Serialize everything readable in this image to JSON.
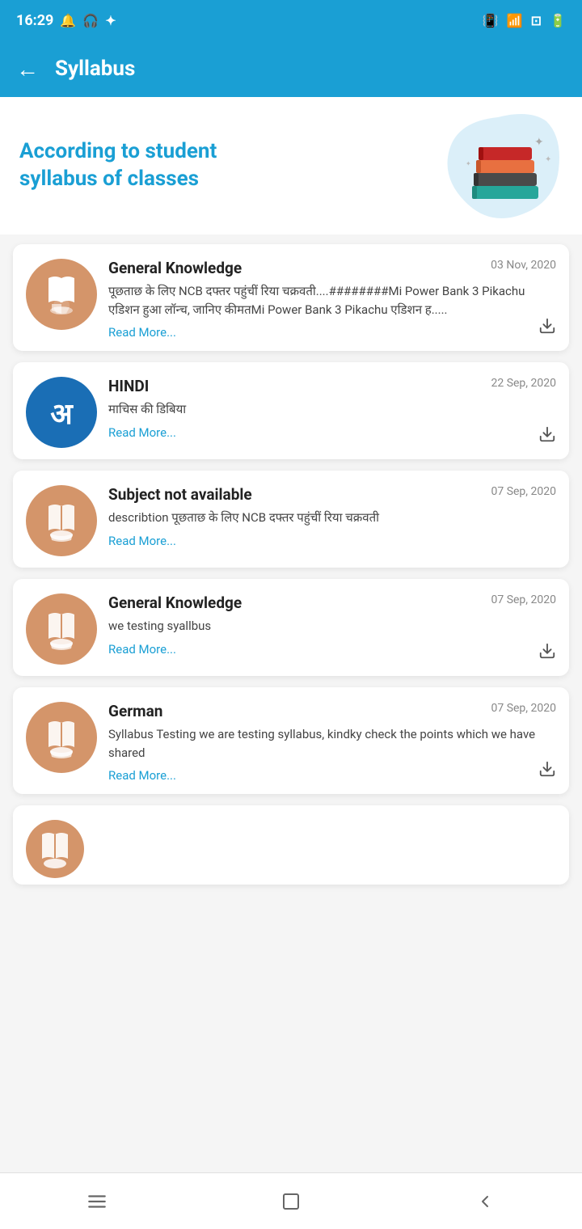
{
  "statusBar": {
    "time": "16:29",
    "icons": [
      "notification",
      "headset",
      "bluetooth",
      "vibrate",
      "wifi",
      "screenshot",
      "battery"
    ]
  },
  "appBar": {
    "title": "Syllabus",
    "backLabel": "←"
  },
  "header": {
    "line1": "According to student",
    "line2": "syllabus of classes"
  },
  "cards": [
    {
      "id": 1,
      "subject": "General Knowledge",
      "date": "03 Nov, 2020",
      "description": "पूछताछ के लिए NCB दफ्तर पहुंचीं रिया चक्रवती....########Mi Power Bank 3 Pikachu एडिशन हुआ लॉन्च, जानिए कीमतMi Power Bank 3 Pikachu एडिशन ह.....",
      "readMore": "Read More...",
      "iconType": "book",
      "iconColor": "orange",
      "hasDownload": true
    },
    {
      "id": 2,
      "subject": "HINDI",
      "date": "22 Sep, 2020",
      "description": "माचिस की डिबिया",
      "readMore": "Read More...",
      "iconType": "hindi",
      "iconColor": "blue",
      "hasDownload": true
    },
    {
      "id": 3,
      "subject": "Subject not available",
      "date": "07 Sep, 2020",
      "description": "describtion पूछताछ के लिए NCB दफ्तर पहुंचीं रिया चक्रवती",
      "readMore": "Read More...",
      "iconType": "book",
      "iconColor": "orange",
      "hasDownload": false
    },
    {
      "id": 4,
      "subject": "General Knowledge",
      "date": "07 Sep, 2020",
      "description": "we testing syallbus",
      "readMore": "Read More...",
      "iconType": "book",
      "iconColor": "orange",
      "hasDownload": true
    },
    {
      "id": 5,
      "subject": "German",
      "date": "07 Sep, 2020",
      "description": "Syllabus Testing we are testing syllabus, kindky check the points which we have shared",
      "readMore": "Read More...",
      "iconType": "book",
      "iconColor": "orange",
      "hasDownload": true
    }
  ],
  "bottomNav": {
    "items": [
      "menu",
      "square",
      "triangle"
    ]
  }
}
